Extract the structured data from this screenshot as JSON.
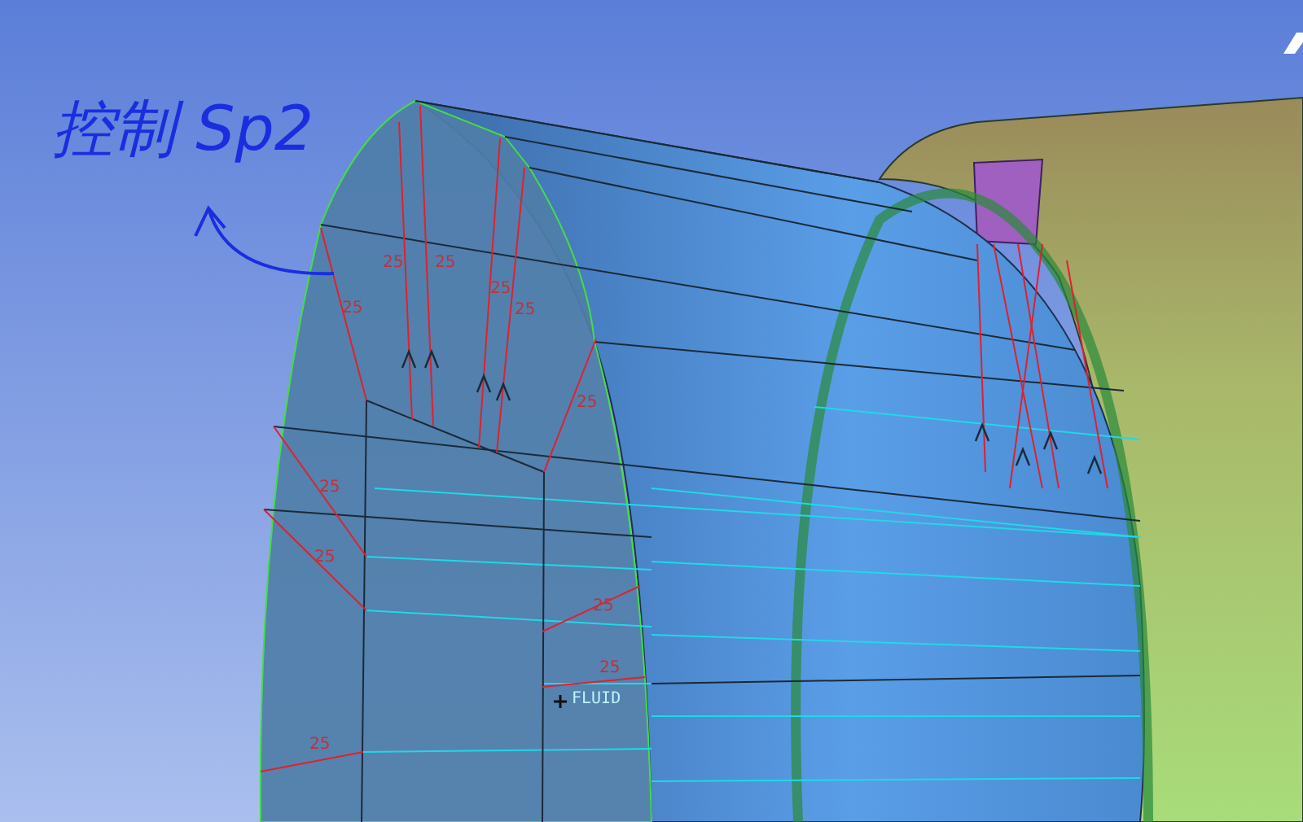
{
  "viewport": {
    "annotation": "控制 Sp2",
    "edge_labels": [
      "25",
      "25",
      "25",
      "25",
      "25",
      "25",
      "25",
      "25",
      "25",
      "25",
      "25"
    ],
    "part_label": "FLUID"
  }
}
